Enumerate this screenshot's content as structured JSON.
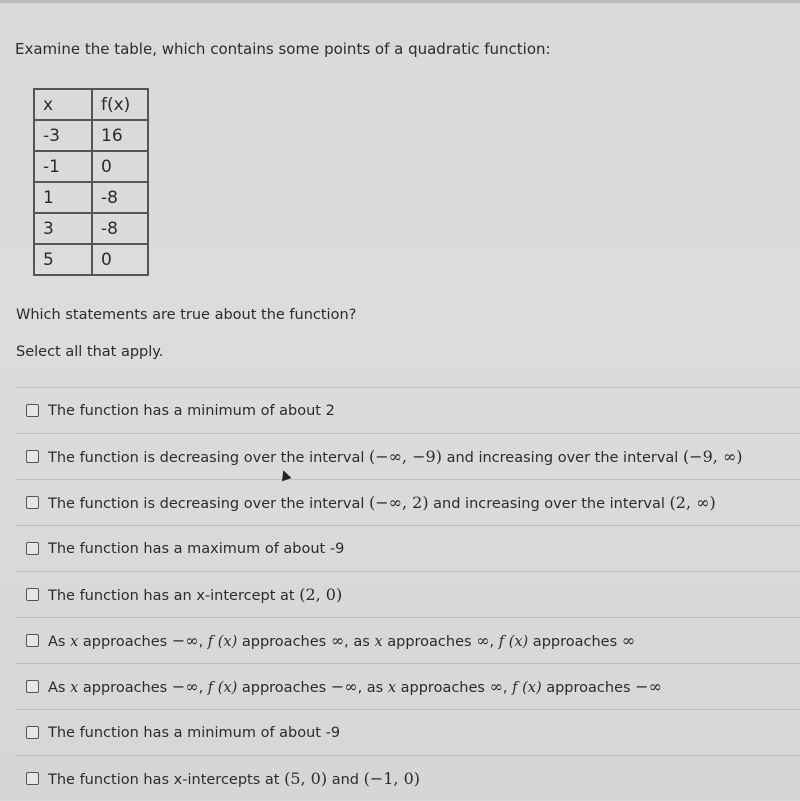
{
  "prompt": "Examine the table, which contains some points of a quadratic function:",
  "table": {
    "headers": [
      "x",
      "f(x)"
    ],
    "rows": [
      [
        "-3",
        "16"
      ],
      [
        "-1",
        "0"
      ],
      [
        "1",
        "-8"
      ],
      [
        "3",
        "-8"
      ],
      [
        "5",
        "0"
      ]
    ]
  },
  "question": "Which statements are true about the function?",
  "instruction": "Select all that apply.",
  "options": [
    {
      "parts": [
        "The function has a minimum of about 2"
      ]
    },
    {
      "parts": [
        "The function is decreasing over the interval ",
        "(−∞, −9)",
        " and increasing over the interval ",
        "(−9, ∞)"
      ]
    },
    {
      "parts": [
        "The function is decreasing over the interval ",
        "(−∞, 2)",
        " and increasing over the interval ",
        "(2, ∞)"
      ]
    },
    {
      "parts": [
        "The function has a maximum of about -9"
      ]
    },
    {
      "parts": [
        "The function has an x-intercept at ",
        "(2, 0)"
      ]
    },
    {
      "parts": [
        "As ",
        "x",
        " approaches ",
        "−∞",
        ", ",
        "f (x)",
        " approaches ",
        "∞",
        ", as ",
        "x",
        " approaches ",
        "∞",
        ", ",
        "f (x)",
        " approaches ",
        "∞"
      ]
    },
    {
      "parts": [
        "As ",
        "x",
        " approaches ",
        "−∞",
        ", ",
        "f (x)",
        " approaches ",
        "−∞",
        ", as ",
        "x",
        " approaches ",
        "∞",
        ", ",
        "f (x)",
        " approaches ",
        "−∞"
      ]
    },
    {
      "parts": [
        "The function has a minimum of about -9"
      ]
    },
    {
      "parts": [
        "The function has x-intercepts at ",
        "(5, 0)",
        " and ",
        "(−1, 0)"
      ]
    }
  ]
}
